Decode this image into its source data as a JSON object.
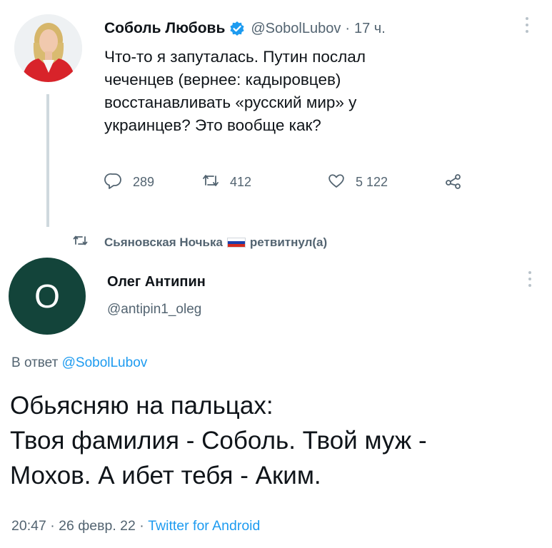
{
  "tweet1": {
    "author_name": "Соболь Любовь",
    "author_handle": "@SobolLubov",
    "dot": "·",
    "time": "17 ч.",
    "text_lines": [
      "Что-то я запуталась. Путин послал",
      "чеченцев (вернее: кадыровцев)",
      "восстанавливать «русский мир» у",
      "украинцев? Это вообще как?"
    ],
    "replies": "289",
    "retweets": "412",
    "likes": "5 122"
  },
  "retweet_line": {
    "user": "Сьяновская Ночька",
    "action": "ретвитнул(а)"
  },
  "tweet2": {
    "avatar_letter": "О",
    "author_name": "Олег Антипин",
    "author_handle": "@antipin1_oleg",
    "reply_prefix": "В ответ",
    "reply_mention": "@SobolLubov",
    "text_lines": [
      "Обьясняю на пальцах:",
      "Твоя фамилия - Соболь. Твой муж -",
      "Мохов. А ибет тебя - Аким."
    ],
    "meta_time": "20:47 · 26 февр. 22 ·",
    "meta_source": "Twitter for Android"
  },
  "colors": {
    "accent_blue": "#1d9bf0",
    "muted_text": "#536471",
    "oleg_avatar": "#13443a"
  },
  "icons": [
    "verified-badge-icon",
    "more-icon",
    "reply-icon",
    "retweet-icon",
    "like-icon",
    "share-icon",
    "russia-flag-icon"
  ]
}
